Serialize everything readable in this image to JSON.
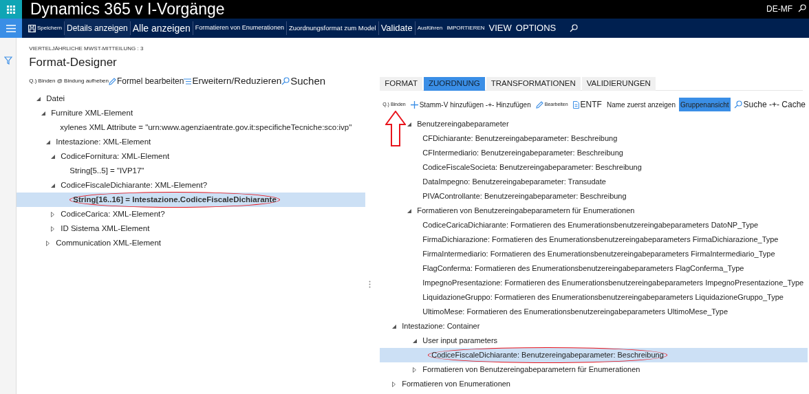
{
  "header": {
    "title": "Dynamics 365 v I-Vorgänge",
    "company": "DE-MF"
  },
  "nav_bar": [
    {
      "label": "Speichern"
    },
    {
      "label": "Details anzeigen"
    },
    {
      "label": "Alle anzeigen"
    },
    {
      "label": "Formatieren von Enumerationen"
    },
    {
      "label": "Zuordnungsformat zum Model"
    },
    {
      "label": "Validate"
    },
    {
      "label": "Ausführen"
    },
    {
      "label": "IMPORTIEREN"
    },
    {
      "label": "VIEW"
    },
    {
      "label": "OPTIONS"
    },
    {
      "kind": "search"
    }
  ],
  "breadcrumb": "VIERTELJÄHRLICHE MWST-MITTEILUNG : 3",
  "page_title": "Format-Designer",
  "format_toolbar": [
    {
      "label": "Q.) Binden @ Bindung aufheben"
    },
    {
      "label": "Formel bearbeiten"
    },
    {
      "label": "Erweitern/Reduzieren"
    },
    {
      "label": "Suchen"
    }
  ],
  "format_tree": [
    {
      "label": "Datei",
      "expanded": true,
      "children": [
        {
          "label": "Furniture XML-Element",
          "expanded": true,
          "children": [
            {
              "label": "xylenes XML Attribute = \"urn:www.agenziaentrate.gov.it:specificheTecniche:sco:ivp\""
            },
            {
              "label": "Intestazione: XML-Element",
              "expanded": true,
              "children": [
                {
                  "label": "CodiceFornitura: XML-Element",
                  "expanded": true,
                  "children": [
                    {
                      "label": "String[5..5] = \"IVP17\""
                    }
                  ]
                },
                {
                  "label": "CodiceFiscaleDichiarante: XML-Element?",
                  "expanded": true,
                  "children": [
                    {
                      "label": "String[16..16] = Intestazione.CodiceFiscaleDichiarante",
                      "selected": true,
                      "circled": true
                    }
                  ]
                },
                {
                  "label": "CodiceCarica: XML-Element?",
                  "expanded": false
                },
                {
                  "label": "ID Sistema XML-Element",
                  "expanded": false
                }
              ]
            },
            {
              "label": "Communication XML-Element",
              "expanded": false
            }
          ]
        }
      ]
    }
  ],
  "tabs": [
    {
      "label": "FORMAT",
      "selected": false
    },
    {
      "label": "ZUORDNUNG",
      "selected": true
    },
    {
      "label": "TRANSFORMATIONEN",
      "selected": false
    },
    {
      "label": "VALIDIERUNGEN",
      "selected": false
    }
  ],
  "mapping_toolbar": [
    {
      "label": "Q.) Binden",
      "selected": false
    },
    {
      "label": "Stamm-V hinzufügen -+- Hinzufügen",
      "selected": false
    },
    {
      "label": "Bearbeiten",
      "selected": false
    },
    {
      "label": "ENTF",
      "selected": false
    },
    {
      "label": "Name zuerst anzeigen",
      "selected": false
    },
    {
      "label": "Gruppenansicht",
      "selected": true
    },
    {
      "label": "Suche -+- Cache",
      "selected": false
    }
  ],
  "mapping_tree": [
    {
      "label": "Benutzereingabeparameter",
      "expanded": true,
      "children": [
        {
          "label": "CFDichiarante: Benutzereingabeparameter: Beschreibung"
        },
        {
          "label": "CFIntermediario: Benutzereingabeparameter: Beschreibung"
        },
        {
          "label": "CodiceFiscaleSocieta: Benutzereingabeparameter: Beschreibung"
        },
        {
          "label": "DataImpegno: Benutzereingabeparameter: Transudate"
        },
        {
          "label": "PIVAControllante: Benutzereingabeparameter: Beschreibung"
        }
      ]
    },
    {
      "label": "Formatieren von Benutzereingabeparametern für Enumerationen",
      "expanded": true,
      "children": [
        {
          "label": "CodiceCaricaDichiarante: Formatieren des Enumerationsbenutzereingabeparameters DatoNP_Type"
        },
        {
          "label": "FirmaDichiarazione: Formatieren des Enumerationsbenutzereingabeparameters FirmaDichiarazione_Type"
        },
        {
          "label": "FirmaIntermediario: Formatieren des Enumerationsbenutzereingabeparameters FirmaIntermediario_Type"
        },
        {
          "label": "FlagConferma: Formatieren des Enumerationsbenutzereingabeparameters FlagConferma_Type"
        },
        {
          "label": "ImpegnoPresentazione: Formatieren des Enumerationsbenutzereingabeparameters ImpegnoPresentazione_Type"
        },
        {
          "label": "LiquidazioneGruppo: Formatieren des Enumerationsbenutzereingabeparameters LiquidazioneGruppo_Type"
        },
        {
          "label": "UltimoMese: Formatieren des Enumerationsbenutzereingabeparameters UltimoMese_Type"
        }
      ]
    },
    {
      "label": "Intestazione: Container",
      "expanded": true,
      "outdent": true,
      "children": [
        {
          "label": "User input parameters",
          "expanded": true,
          "children": [
            {
              "label": "CodiceFiscaleDichiarante: Benutzereingabeparameter: Beschreibung",
              "selected": true,
              "circled": true
            }
          ]
        },
        {
          "label": "Formatieren von Benutzereingabeparametern für Enumerationen",
          "expanded": false
        }
      ]
    },
    {
      "label": "Formatieren von Enumerationen",
      "expanded": false,
      "outdent": true
    }
  ]
}
